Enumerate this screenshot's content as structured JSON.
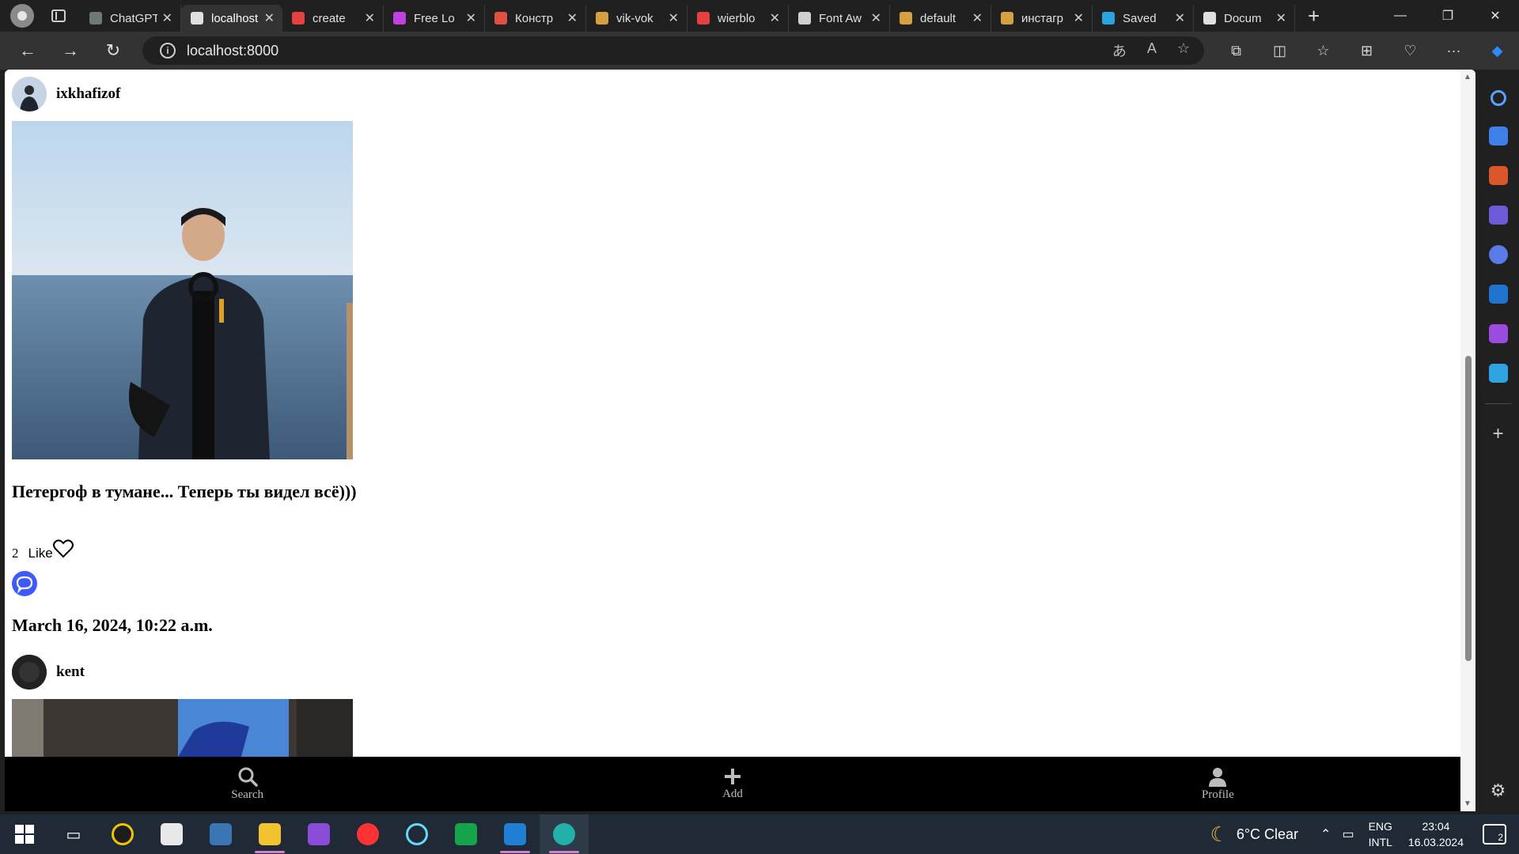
{
  "browser": {
    "tabs": [
      {
        "title": "ChatGPT",
        "color": "#6b7b73"
      },
      {
        "title": "localhost",
        "color": "#e0e0e0",
        "active": true
      },
      {
        "title": "create",
        "color": "#e64040"
      },
      {
        "title": "Free Lo",
        "color": "#c040e0"
      },
      {
        "title": "Констр",
        "color": "#e05040"
      },
      {
        "title": "vik-vok",
        "color": "#d6a040"
      },
      {
        "title": "wierblo",
        "color": "#e64040"
      },
      {
        "title": "Font Aw",
        "color": "#d0d0d0"
      },
      {
        "title": "default",
        "color": "#d6a040"
      },
      {
        "title": "инстагр",
        "color": "#d6a040"
      },
      {
        "title": "Saved",
        "color": "#2aa3e0"
      },
      {
        "title": "Docum",
        "color": "#e0e0e0"
      }
    ],
    "address": "localhost:8000"
  },
  "feed": {
    "post1": {
      "username": "ixkhafizof",
      "caption": "Петергоф в тумане... Теперь ты видел всё)))",
      "likes_count": "2",
      "like_label": "Like",
      "date": "March 16, 2024, 10:22 a.m."
    },
    "post2": {
      "username": "kent"
    }
  },
  "bottom_nav": {
    "search": "Search",
    "add": "Add",
    "profile": "Profile"
  },
  "taskbar": {
    "weather": "6°C  Clear",
    "lang_top": "ENG",
    "lang_bottom": "INTL",
    "time": "23:04",
    "date": "16.03.2024",
    "notifications": "2"
  },
  "colors": {
    "comment_icon": "#3d5afe",
    "nav_bg": "#000000"
  }
}
